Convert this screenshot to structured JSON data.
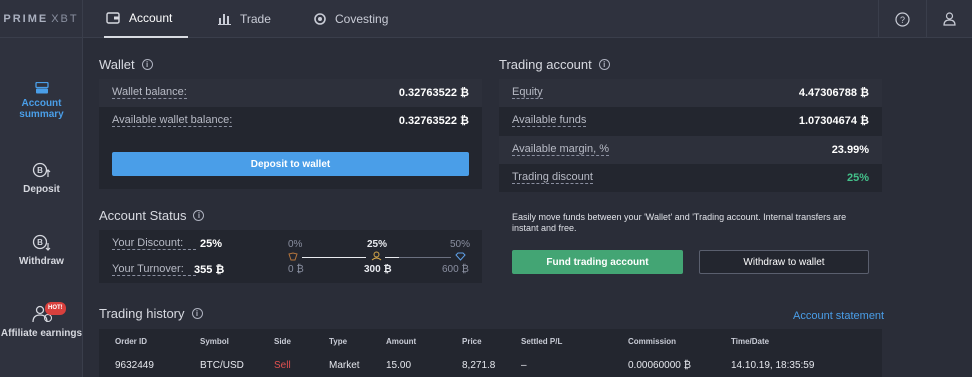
{
  "app": {
    "logo_bold": "PRIME",
    "logo_thin": "XBT"
  },
  "tabs": [
    {
      "label": "Account",
      "icon": "wallet-icon",
      "active": true
    },
    {
      "label": "Trade",
      "icon": "chart-icon",
      "active": false
    },
    {
      "label": "Covesting",
      "icon": "covesting-icon",
      "active": false
    }
  ],
  "top_right": {
    "help_icon": "help-icon",
    "user_icon": "user-icon"
  },
  "sidebar": {
    "items": [
      {
        "label_l1": "Account",
        "label_l2": "summary",
        "icon": "account-summary-icon",
        "active": true
      },
      {
        "label_l1": "Deposit",
        "label_l2": "",
        "icon": "bitcoin-deposit-icon",
        "active": false
      },
      {
        "label_l1": "Withdraw",
        "label_l2": "",
        "icon": "bitcoin-withdraw-icon",
        "active": false
      },
      {
        "label_l1": "Affiliate earnings",
        "label_l2": "",
        "icon": "affiliate-icon",
        "badge": "HOT!",
        "active": false
      }
    ]
  },
  "wallet": {
    "title": "Wallet",
    "rows": [
      {
        "label": "Wallet balance:",
        "value": "0.32763522 ₿"
      },
      {
        "label": "Available wallet balance:",
        "value": "0.32763522 ₿"
      }
    ],
    "deposit_button": "Deposit to wallet",
    "colors": {
      "primary": "#4a9ee8"
    }
  },
  "account_status": {
    "title": "Account Status",
    "discount_label": "Your Discount:",
    "discount_value": "25%",
    "turnover_label": "Your Turnover:",
    "turnover_value": "355 ₿",
    "tiers": [
      {
        "pct": "0%",
        "amount": "0 ₿",
        "reached": true
      },
      {
        "pct": "25%",
        "amount": "300 ₿",
        "reached": true
      },
      {
        "pct": "50%",
        "amount": "600 ₿",
        "reached": false
      }
    ],
    "progress_to_next_tier": 0.18
  },
  "trading_account": {
    "title": "Trading account",
    "rows": [
      {
        "label": "Equity",
        "value": "4.47306788 ₿"
      },
      {
        "label": "Available funds",
        "value": "1.07304674 ₿"
      },
      {
        "label": "Available margin, %",
        "value": "23.99%"
      },
      {
        "label": "Trading discount",
        "value": "25%"
      }
    ],
    "note": "Easily move funds between your 'Wallet' and 'Trading account. Internal transfers are instant and free.",
    "fund_button": "Fund trading account",
    "withdraw_button": "Withdraw to wallet",
    "colors": {
      "fund": "#43a574",
      "discount": "#43c08a"
    }
  },
  "trading_history": {
    "title": "Trading history",
    "statement_link": "Account statement",
    "columns": [
      "Order ID",
      "Symbol",
      "Side",
      "Type",
      "Amount",
      "Price",
      "Settled P/L",
      "Commission",
      "Time/Date"
    ],
    "rows": [
      [
        "9632449",
        "BTC/USD",
        "Sell",
        "Market",
        "15.00",
        "8,271.8",
        "–",
        "0.00060000 ₿",
        "14.10.19, 18:35:59"
      ]
    ],
    "colors": {
      "sell": "#e05050"
    }
  }
}
